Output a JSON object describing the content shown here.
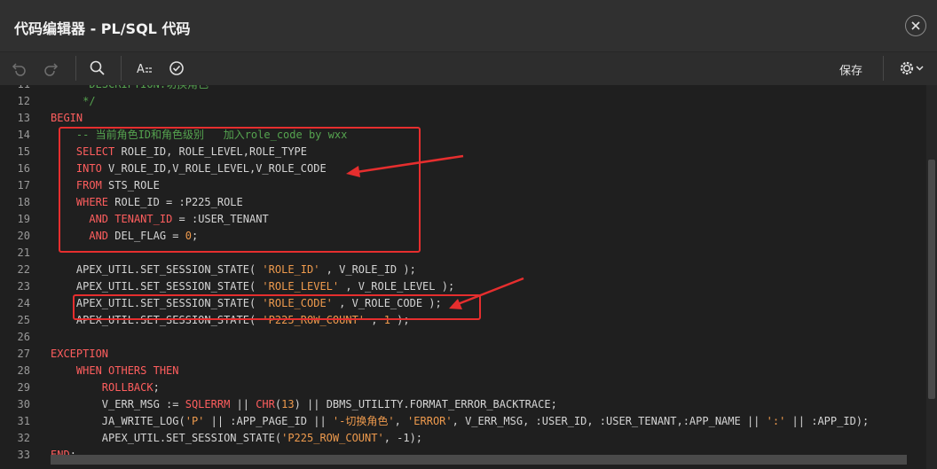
{
  "window": {
    "title": "代码编辑器 - PL/SQL 代码"
  },
  "toolbar": {
    "undo_icon": "undo-icon",
    "redo_icon": "redo-icon",
    "search_icon": "search-icon",
    "format_icon": "text-format-icon",
    "validate_icon": "check-circle-icon",
    "save_label": "保存",
    "settings_icon": "gear-icon"
  },
  "colors": {
    "background": "#1f1f1f",
    "keyword": "#ff5e5e",
    "string": "#ee9a4d",
    "comment": "#55a34f",
    "text": "#d4d4d4",
    "annotation": "#e62e2e"
  },
  "code_lines": [
    {
      "n": "11",
      "tokens": [
        [
          "c",
          "      DESCRIPTION:切换角色"
        ]
      ]
    },
    {
      "n": "12",
      "tokens": [
        [
          "c",
          "     */"
        ]
      ]
    },
    {
      "n": "13",
      "tokens": [
        [
          "k",
          "BEGIN"
        ]
      ]
    },
    {
      "n": "14",
      "tokens": [
        [
          "p",
          "    "
        ],
        [
          "c",
          "-- 当前角色ID和角色级别   加入role_code by wxx"
        ]
      ]
    },
    {
      "n": "15",
      "tokens": [
        [
          "p",
          "    "
        ],
        [
          "k",
          "SELECT"
        ],
        [
          "p",
          " ROLE_ID, ROLE_LEVEL,ROLE_TYPE"
        ]
      ]
    },
    {
      "n": "16",
      "tokens": [
        [
          "p",
          "    "
        ],
        [
          "k",
          "INTO"
        ],
        [
          "p",
          " V_ROLE_ID,V_ROLE_LEVEL,V_ROLE_CODE"
        ]
      ]
    },
    {
      "n": "17",
      "tokens": [
        [
          "p",
          "    "
        ],
        [
          "k",
          "FROM"
        ],
        [
          "p",
          " STS_ROLE"
        ]
      ]
    },
    {
      "n": "18",
      "tokens": [
        [
          "p",
          "    "
        ],
        [
          "k",
          "WHERE"
        ],
        [
          "p",
          " ROLE_ID = :P225_ROLE"
        ]
      ]
    },
    {
      "n": "19",
      "tokens": [
        [
          "p",
          "      "
        ],
        [
          "k",
          "AND"
        ],
        [
          "p",
          " "
        ],
        [
          "k",
          "TENANT_ID"
        ],
        [
          "p",
          " = :USER_TENANT"
        ]
      ]
    },
    {
      "n": "20",
      "tokens": [
        [
          "p",
          "      "
        ],
        [
          "k",
          "AND"
        ],
        [
          "p",
          " DEL_FLAG = "
        ],
        [
          "s",
          "0"
        ],
        [
          "p",
          ";"
        ]
      ]
    },
    {
      "n": "21",
      "tokens": []
    },
    {
      "n": "22",
      "tokens": [
        [
          "p",
          "    APEX_UTIL.SET_SESSION_STATE( "
        ],
        [
          "s",
          "'ROLE_ID'"
        ],
        [
          "p",
          " , V_ROLE_ID );"
        ]
      ]
    },
    {
      "n": "23",
      "tokens": [
        [
          "p",
          "    APEX_UTIL.SET_SESSION_STATE( "
        ],
        [
          "s",
          "'ROLE_LEVEL'"
        ],
        [
          "p",
          " , V_ROLE_LEVEL );"
        ]
      ]
    },
    {
      "n": "24",
      "tokens": [
        [
          "p",
          "    APEX_UTIL.SET_SESSION_STATE( "
        ],
        [
          "s",
          "'ROLE_CODE'"
        ],
        [
          "p",
          " , V_ROLE_CODE );"
        ]
      ]
    },
    {
      "n": "25",
      "tokens": [
        [
          "p",
          "    APEX_UTIL.SET_SESSION_STATE( "
        ],
        [
          "s",
          "'P225_ROW_COUNT'"
        ],
        [
          "p",
          " , "
        ],
        [
          "s",
          "1"
        ],
        [
          "p",
          " );"
        ]
      ]
    },
    {
      "n": "26",
      "tokens": []
    },
    {
      "n": "27",
      "tokens": [
        [
          "k",
          "EXCEPTION"
        ]
      ]
    },
    {
      "n": "28",
      "tokens": [
        [
          "p",
          "    "
        ],
        [
          "k",
          "WHEN OTHERS THEN"
        ]
      ]
    },
    {
      "n": "29",
      "tokens": [
        [
          "p",
          "        "
        ],
        [
          "k",
          "ROLLBACK"
        ],
        [
          "p",
          ";"
        ]
      ]
    },
    {
      "n": "30",
      "tokens": [
        [
          "p",
          "        V_ERR_MSG := "
        ],
        [
          "k",
          "SQLERRM"
        ],
        [
          "p",
          " || "
        ],
        [
          "k",
          "CHR"
        ],
        [
          "p",
          "("
        ],
        [
          "s",
          "13"
        ],
        [
          "p",
          ") || DBMS_UTILITY.FORMAT_ERROR_BACKTRACE;"
        ]
      ]
    },
    {
      "n": "31",
      "tokens": [
        [
          "p",
          "        JA_WRITE_LOG("
        ],
        [
          "s",
          "'P'"
        ],
        [
          "p",
          " || :APP_PAGE_ID || "
        ],
        [
          "s",
          "'-切换角色'"
        ],
        [
          "p",
          ", "
        ],
        [
          "s",
          "'ERROR'"
        ],
        [
          "p",
          ", V_ERR_MSG, :USER_ID, :USER_TENANT,:APP_NAME || "
        ],
        [
          "s",
          "':'"
        ],
        [
          "p",
          " || :APP_ID);"
        ]
      ]
    },
    {
      "n": "32",
      "tokens": [
        [
          "p",
          "        APEX_UTIL.SET_SESSION_STATE("
        ],
        [
          "s",
          "'P225_ROW_COUNT'"
        ],
        [
          "p",
          ", -1);"
        ]
      ]
    },
    {
      "n": "33",
      "tokens": [
        [
          "k",
          "END"
        ],
        [
          "p",
          ";"
        ]
      ]
    }
  ]
}
